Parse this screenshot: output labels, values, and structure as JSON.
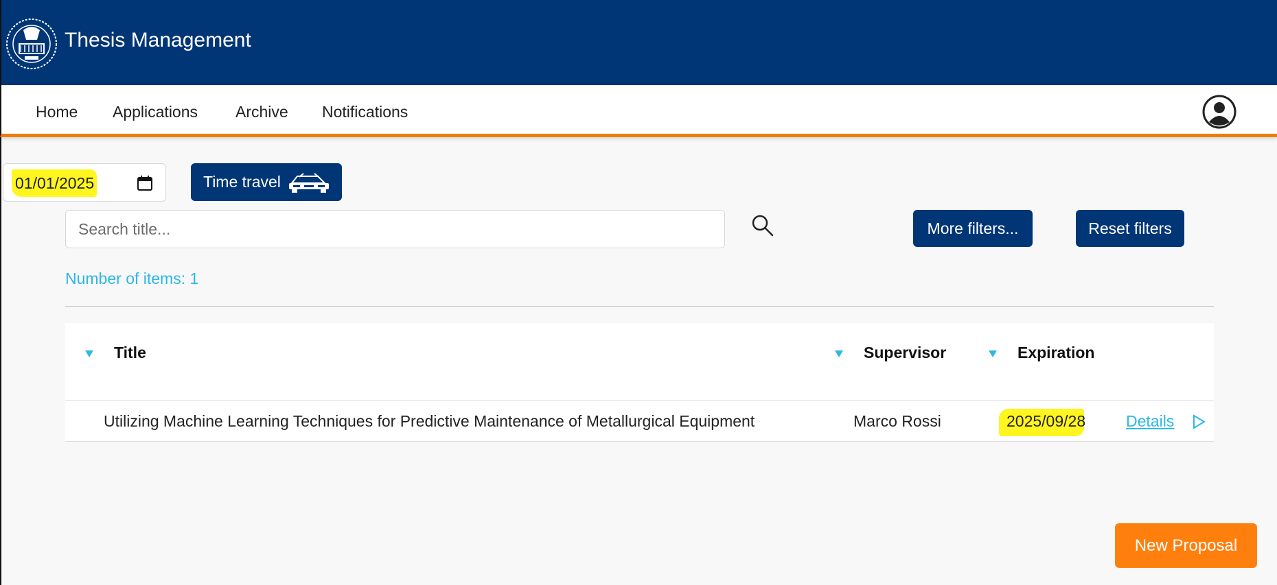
{
  "header": {
    "app_title": "Thesis Management",
    "logo_icon": "university-seal-icon",
    "brand_color": "#003576"
  },
  "nav": {
    "items": [
      {
        "label": "Home"
      },
      {
        "label": "Applications"
      },
      {
        "label": "Archive"
      },
      {
        "label": "Notifications"
      }
    ],
    "profile_icon": "user-circle-icon",
    "accent_color": "#ef7d00"
  },
  "time_travel": {
    "date_value": "01/01/2025",
    "calendar_icon": "calendar-icon",
    "button_label": "Time travel",
    "car_icon": "car-icon"
  },
  "search": {
    "placeholder": "Search title...",
    "search_icon": "magnifier-icon"
  },
  "filters": {
    "more_label": "More filters...",
    "reset_label": "Reset filters"
  },
  "results": {
    "count_text": "Number of items: 1"
  },
  "table": {
    "columns": [
      {
        "label": "Title",
        "sort_icon": "sort-down-icon"
      },
      {
        "label": "Supervisor",
        "sort_icon": "sort-down-icon"
      },
      {
        "label": "Expiration",
        "sort_icon": "sort-down-icon"
      }
    ],
    "rows": [
      {
        "title": "Utilizing Machine Learning Techniques for Predictive Maintenance of Metallurgical Equipment",
        "supervisor": "Marco Rossi",
        "expiration": "2025/09/28",
        "details_label": "Details",
        "action_icon": "play-icon"
      }
    ]
  },
  "actions": {
    "new_proposal_label": "New Proposal",
    "new_proposal_color": "#ff7f0e"
  },
  "highlight_color": "#fff51f",
  "link_color": "#2cb8e6"
}
